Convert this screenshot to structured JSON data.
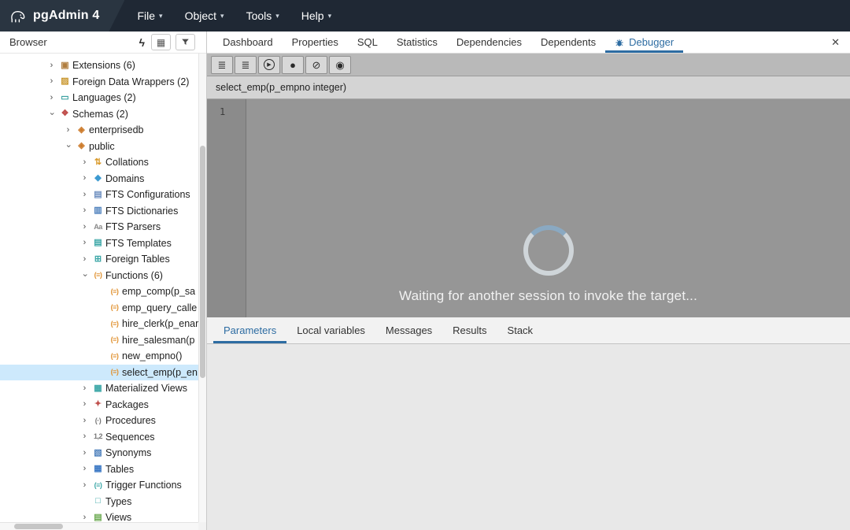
{
  "colors": {
    "accent_blue": "#2d6ca2",
    "selection_blue": "#cde9fc",
    "header_bg": "#1f2834"
  },
  "header": {
    "app_title": "pgAdmin 4",
    "caret": "▾",
    "menus": [
      {
        "label": "File"
      },
      {
        "label": "Object"
      },
      {
        "label": "Tools"
      },
      {
        "label": "Help"
      }
    ]
  },
  "browser": {
    "title": "Browser",
    "icons": {
      "lightning": "ϟ",
      "grid": "▦"
    },
    "chevron": "›",
    "tree": [
      {
        "label": "Extensions (6)",
        "level": 0,
        "state": "collapsed",
        "icon": "extension-icon",
        "glyph": "▣",
        "color": "#b07d3e"
      },
      {
        "label": "Foreign Data Wrappers (2)",
        "level": 0,
        "state": "collapsed",
        "icon": "foreign-data-wrapper-icon",
        "glyph": "▨",
        "color": "#c9972f"
      },
      {
        "label": "Languages (2)",
        "level": 0,
        "state": "collapsed",
        "icon": "language-icon",
        "glyph": "▭",
        "color": "#3aa0a0"
      },
      {
        "label": "Schemas (2)",
        "level": 0,
        "state": "expanded",
        "icon": "schemas-icon",
        "glyph": "❖",
        "color": "#c0504d"
      },
      {
        "label": "enterprisedb",
        "level": 1,
        "state": "collapsed",
        "icon": "schema-icon",
        "glyph": "◈",
        "color": "#cc7a29"
      },
      {
        "label": "public",
        "level": 1,
        "state": "expanded",
        "icon": "schema-icon",
        "glyph": "◈",
        "color": "#cc7a29"
      },
      {
        "label": "Collations",
        "level": 2,
        "state": "collapsed",
        "icon": "collation-icon",
        "glyph": "⇅",
        "color": "#d99a2b"
      },
      {
        "label": "Domains",
        "level": 2,
        "state": "collapsed",
        "icon": "domain-icon",
        "glyph": "◆",
        "color": "#3c9ad1"
      },
      {
        "label": "FTS Configurations",
        "level": 2,
        "state": "collapsed",
        "icon": "fts-configuration-icon",
        "glyph": "▤",
        "color": "#6c8ebf"
      },
      {
        "label": "FTS Dictionaries",
        "level": 2,
        "state": "collapsed",
        "icon": "fts-dictionary-icon",
        "glyph": "▥",
        "color": "#4a7ebb"
      },
      {
        "label": "FTS Parsers",
        "level": 2,
        "state": "collapsed",
        "icon": "fts-parser-icon",
        "glyph": "Aa",
        "color": "#8a8a8a"
      },
      {
        "label": "FTS Templates",
        "level": 2,
        "state": "collapsed",
        "icon": "fts-template-icon",
        "glyph": "▤",
        "color": "#3aa6a6"
      },
      {
        "label": "Foreign Tables",
        "level": 2,
        "state": "collapsed",
        "icon": "foreign-table-icon",
        "glyph": "⊞",
        "color": "#3aa6a6"
      },
      {
        "label": "Functions (6)",
        "level": 2,
        "state": "expanded",
        "icon": "functions-icon",
        "glyph": "(≡)",
        "color": "#e0912f"
      },
      {
        "label": "emp_comp(p_sa",
        "level": 3,
        "state": "leaf",
        "icon": "function-icon",
        "glyph": "(≡)",
        "color": "#e0912f"
      },
      {
        "label": "emp_query_calle",
        "level": 3,
        "state": "leaf",
        "icon": "function-icon",
        "glyph": "(≡)",
        "color": "#e0912f"
      },
      {
        "label": "hire_clerk(p_enar",
        "level": 3,
        "state": "leaf",
        "icon": "function-icon",
        "glyph": "(≡)",
        "color": "#e0912f"
      },
      {
        "label": "hire_salesman(p",
        "level": 3,
        "state": "leaf",
        "icon": "function-icon",
        "glyph": "(≡)",
        "color": "#e0912f"
      },
      {
        "label": "new_empno()",
        "level": 3,
        "state": "leaf",
        "icon": "function-icon",
        "glyph": "(≡)",
        "color": "#e0912f"
      },
      {
        "label": "select_emp(p_en",
        "level": 3,
        "state": "leaf",
        "icon": "function-icon",
        "glyph": "(≡)",
        "color": "#e0912f",
        "selected": true
      },
      {
        "label": "Materialized Views",
        "level": 2,
        "state": "collapsed",
        "icon": "materialized-view-icon",
        "glyph": "▦",
        "color": "#3aa6a6"
      },
      {
        "label": "Packages",
        "level": 2,
        "state": "collapsed",
        "icon": "package-icon",
        "glyph": "✦",
        "color": "#c0504d"
      },
      {
        "label": "Procedures",
        "level": 2,
        "state": "collapsed",
        "icon": "procedure-icon",
        "glyph": "(·)",
        "color": "#777777"
      },
      {
        "label": "Sequences",
        "level": 2,
        "state": "collapsed",
        "icon": "sequence-icon",
        "glyph": "1,2",
        "color": "#777777"
      },
      {
        "label": "Synonyms",
        "level": 2,
        "state": "collapsed",
        "icon": "synonym-icon",
        "glyph": "▧",
        "color": "#4a7ebb"
      },
      {
        "label": "Tables",
        "level": 2,
        "state": "collapsed",
        "icon": "table-icon",
        "glyph": "▦",
        "color": "#3b78c4"
      },
      {
        "label": "Trigger Functions",
        "level": 2,
        "state": "collapsed",
        "icon": "trigger-function-icon",
        "glyph": "(≡)",
        "color": "#3aa6a6"
      },
      {
        "label": "Types",
        "level": 2,
        "state": "leaf",
        "icon": "type-icon",
        "glyph": "□",
        "color": "#3aa6a6"
      },
      {
        "label": "Views",
        "level": 2,
        "state": "collapsed",
        "icon": "view-icon",
        "glyph": "▤",
        "color": "#6aa84f"
      }
    ]
  },
  "main_tabs": {
    "close_glyph": "✕",
    "tabs": [
      {
        "label": "Dashboard"
      },
      {
        "label": "Properties"
      },
      {
        "label": "SQL"
      },
      {
        "label": "Statistics"
      },
      {
        "label": "Dependencies"
      },
      {
        "label": "Dependents"
      },
      {
        "label": "Debugger",
        "active": true,
        "icon": "bug-icon"
      }
    ]
  },
  "debugger": {
    "toolbar": [
      {
        "name": "step-into",
        "glyph": "≣"
      },
      {
        "name": "step-over",
        "glyph": "≣"
      },
      {
        "name": "continue",
        "glyph": "▶",
        "circled": true
      },
      {
        "name": "stop",
        "glyph": "●"
      },
      {
        "name": "cancel",
        "glyph": "⊘"
      },
      {
        "name": "toggle-breakpoint",
        "glyph": "◉"
      }
    ],
    "signature": "select_emp(p_empno integer)",
    "editor": {
      "line_number": "1"
    },
    "waiting_text": "Waiting for another session to invoke the target...",
    "bottom_tabs": [
      {
        "label": "Parameters",
        "active": true
      },
      {
        "label": "Local variables"
      },
      {
        "label": "Messages"
      },
      {
        "label": "Results"
      },
      {
        "label": "Stack"
      }
    ]
  }
}
